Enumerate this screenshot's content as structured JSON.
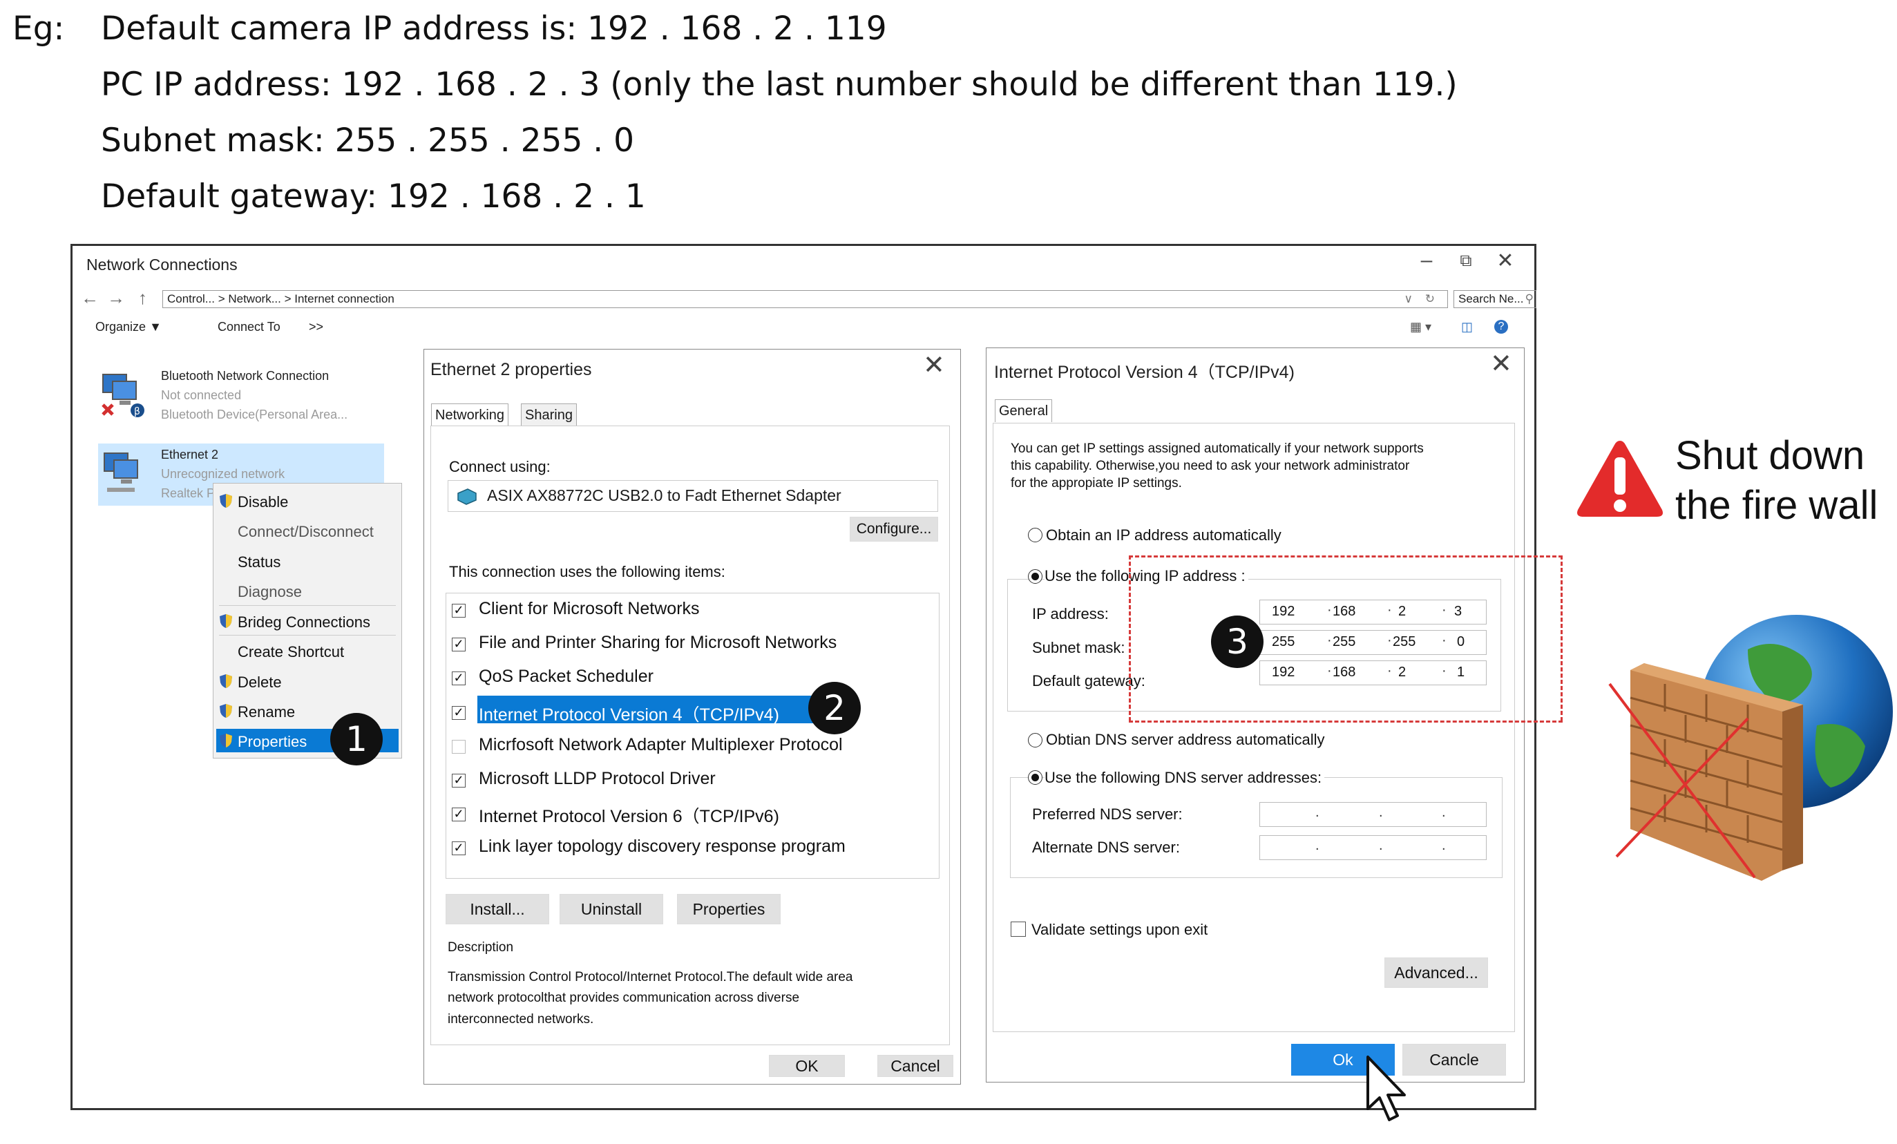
{
  "intro": {
    "eg_label": "Eg:",
    "line1": "Default camera IP address is: 192 . 168 . 2 . 119",
    "line2": "PC IP address: 192 . 168 . 2 . 3 (only the last number should be different than 119.)",
    "line3": "Subnet mask: 255 . 255 . 255 . 0",
    "line4": "Default gateway: 192 . 168 . 2 . 1"
  },
  "window": {
    "title": "Network Connections",
    "address_bar": "Control... > Network... > Internet connection",
    "search_placeholder": "Search Ne...",
    "toolbar": {
      "organize": "Organize",
      "connect_to": "Connect To",
      "more": ">>"
    },
    "connections": [
      {
        "name": "Bluetooth Network Connection",
        "status": "Not connected",
        "device": "Bluetooth Device(Personal Area..."
      },
      {
        "name": "Ethernet 2",
        "status": "Unrecognized network",
        "device": "Realtek P"
      }
    ],
    "context_menu": [
      {
        "label": "Disable",
        "shield": true
      },
      {
        "label": "Connect/Disconnect",
        "shield": false
      },
      {
        "label": "Status",
        "shield": false
      },
      {
        "label": "Diagnose",
        "shield": false
      },
      {
        "label": "Brideg Connections",
        "shield": true
      },
      {
        "label": "Create Shortcut",
        "shield": false
      },
      {
        "label": "Delete",
        "shield": true
      },
      {
        "label": "Rename",
        "shield": true
      },
      {
        "label": "Properties",
        "shield": true,
        "selected": true
      }
    ]
  },
  "eth_dialog": {
    "title": "Ethernet 2 properties",
    "tabs": [
      "Networking",
      "Sharing"
    ],
    "connect_using_label": "Connect using:",
    "adapter": "ASIX AX88772C USB2.0 to Fadt Ethernet Sdapter",
    "configure": "Configure...",
    "items_label": "This connection uses the following items:",
    "items": [
      {
        "label": "Client for Microsoft Networks",
        "checked": true
      },
      {
        "label": "File and Printer Sharing for Microsoft Networks",
        "checked": true
      },
      {
        "label": "QoS Packet Scheduler",
        "checked": true
      },
      {
        "label": "Internet Protocol Version 4（TCP/IPv4)",
        "checked": true,
        "selected": true
      },
      {
        "label": "Micrfosoft Network Adapter Multiplexer Protocol",
        "checked": false
      },
      {
        "label": "Microsoft LLDP Protocol Driver",
        "checked": true
      },
      {
        "label": "Internet Protocol Version 6（TCP/IPv6)",
        "checked": true
      },
      {
        "label": "Link layer topology discovery response program",
        "checked": true
      }
    ],
    "install": "Install...",
    "uninstall": "Uninstall",
    "properties": "Properties",
    "description_label": "Description",
    "description_lines": [
      "Transmission Control Protocol/Internet Protocol.The default wide area",
      "network protocolthat provides communication across diverse",
      "interconnected networks."
    ],
    "ok": "OK",
    "cancel": "Cancel"
  },
  "ipv4_dialog": {
    "title": "Internet Protocol Version 4（TCP/IPv4)",
    "tab": "General",
    "info_lines": [
      "You can get IP settings assigned automatically if your network supports",
      "this capability. Otherwise,you need to ask your network administrator",
      "for the appropiate IP settings."
    ],
    "obtain_auto": "Obtain an IP address automatically",
    "use_following": "Use the following IP address :",
    "ip_label": "IP address:",
    "ip": [
      "192",
      "168",
      "2",
      "3"
    ],
    "subnet_label": "Subnet mask:",
    "subnet": [
      "255",
      "255",
      "255",
      "0"
    ],
    "gateway_label": "Default gateway:",
    "gateway": [
      "192",
      "168",
      "2",
      "1"
    ],
    "dns_auto": "Obtian DNS server address automatically",
    "dns_manual": "Use the following DNS server addresses:",
    "preferred_dns_label": "Preferred NDS server:",
    "alternate_dns_label": "Alternate DNS server:",
    "validate": "Validate settings upon exit",
    "advanced": "Advanced...",
    "ok": "Ok",
    "cancel": "Cancle"
  },
  "steps": [
    "1",
    "2",
    "3"
  ],
  "firewall_note": {
    "line1": "Shut down",
    "line2": "the fire wall"
  },
  "colors": {
    "selection": "#0078d7",
    "ok_button": "#1e88e5",
    "dash_red": "#d63a3a",
    "warning_red": "#e32b2b"
  }
}
